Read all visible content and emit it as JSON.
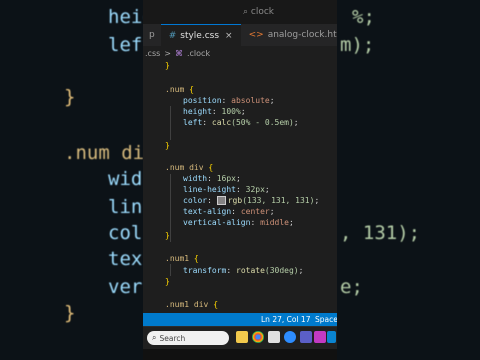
{
  "background_code": {
    "l1": "heig",
    "l1_val": "%;",
    "l2": "left",
    "l2_val": "m);",
    "l3": "}",
    "l4_sel": ".num di",
    "l5": "wid",
    "l6": "lin",
    "l7": "col",
    "l7_val": ", 131);",
    "l8": "tex",
    "l9": "ver",
    "l9_val": "e;",
    "l10": "}"
  },
  "titlebar": {
    "search_text": "clock"
  },
  "tabs": [
    {
      "icon": "css-file-icon",
      "label": "style.css",
      "active": true
    },
    {
      "icon": "html-file-icon",
      "label": "analog-clock.html",
      "active": false
    }
  ],
  "tab_prefix": "p",
  "breadcrumb": {
    "file": ".css",
    "sep": ">",
    "symbol": ".clock"
  },
  "code": {
    "c0": "}",
    "c1_sel": ".num",
    "c1_b": "{",
    "c2_p": "position",
    "c2_v": "absolute",
    "c3_p": "height",
    "c3_v": "100%",
    "c4_p": "left",
    "c4_f": "calc",
    "c4_v": "(50% - 0.5em)",
    "c5": "}",
    "c6_sel": ".num div",
    "c6_b": "{",
    "c7_p": "width",
    "c7_v": "16px",
    "c8_p": "line-height",
    "c8_v": "32px",
    "c9_p": "color",
    "c9_f": "rgb",
    "c9_v": "(133, 131, 131)",
    "c10_p": "text-align",
    "c10_v": "center",
    "c11_p": "vertical-align",
    "c11_v": "middle",
    "c12": "}",
    "c13_sel": ".num1",
    "c13_b": "{",
    "c14_p": "transform",
    "c14_f": "rotate",
    "c14_v": "(30deg)",
    "c15": "}",
    "c16_sel": ".num1 div",
    "c16_b": "{"
  },
  "statusbar": {
    "position": "Ln 27, Col 17",
    "spaces": "Space"
  },
  "taskbar": {
    "search_label": "Search",
    "icons": [
      "file-explorer-icon",
      "chrome-icon",
      "edge-icon",
      "zoom-icon",
      "teams-icon",
      "app-icon",
      "vscode-icon"
    ]
  },
  "colors": {
    "accent": "#007acc",
    "editor_bg": "#1e1e1e",
    "taskbar_bg": "#202020"
  }
}
